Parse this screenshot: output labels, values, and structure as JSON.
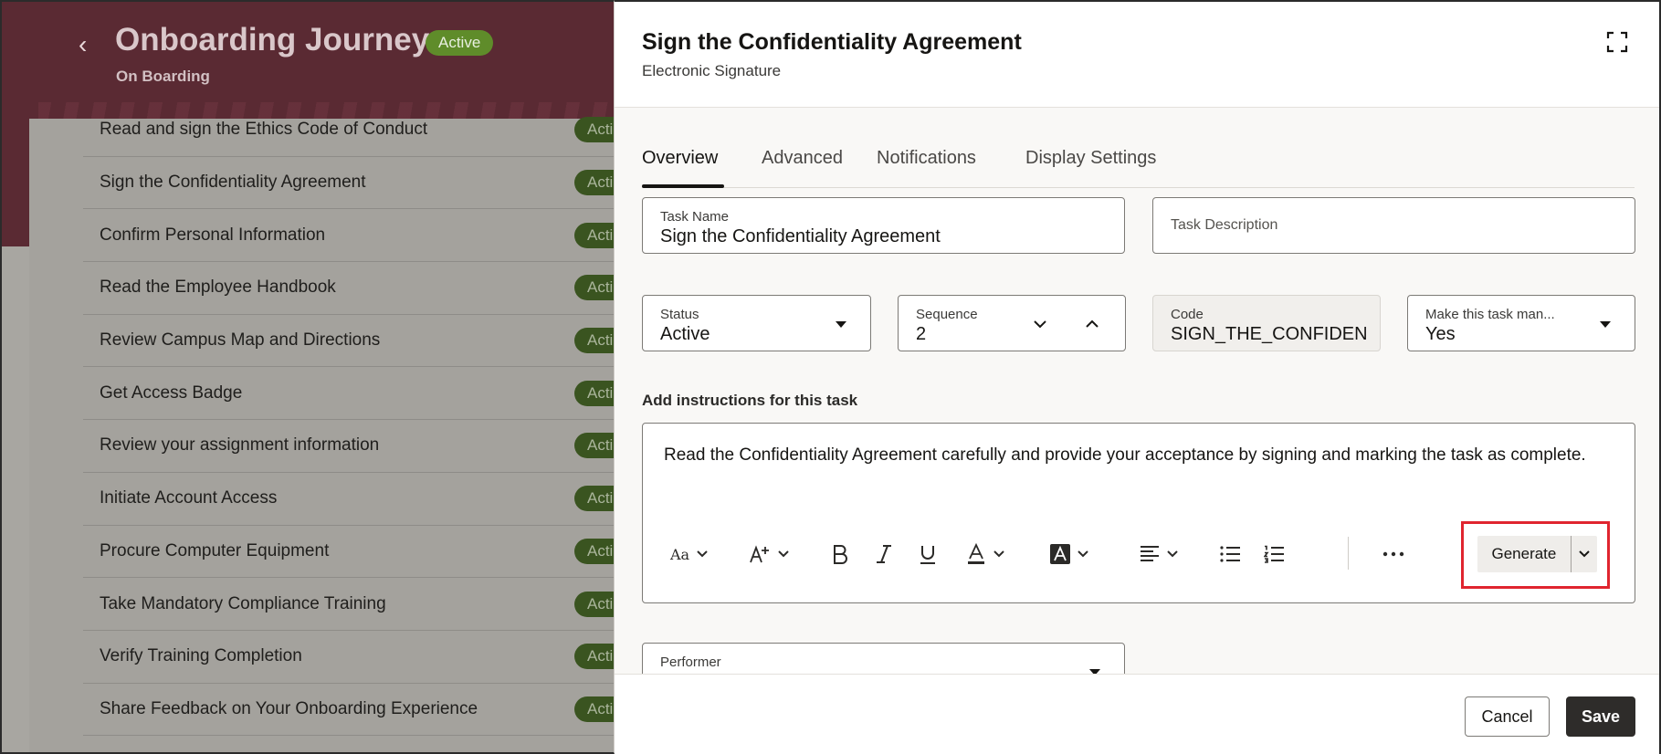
{
  "journey": {
    "title": "Onboarding Journey",
    "status_badge": "Active",
    "subtitle": "On Boarding",
    "tasks": [
      {
        "label": "Read and sign the Ethics Code of Conduct",
        "badge": "Acti"
      },
      {
        "label": "Sign the Confidentiality Agreement",
        "badge": "Acti"
      },
      {
        "label": "Confirm Personal Information",
        "badge": "Acti"
      },
      {
        "label": "Read the Employee Handbook",
        "badge": "Acti"
      },
      {
        "label": "Review Campus Map and Directions",
        "badge": "Acti"
      },
      {
        "label": "Get Access Badge",
        "badge": "Acti"
      },
      {
        "label": "Review your assignment information",
        "badge": "Acti"
      },
      {
        "label": "Initiate Account Access",
        "badge": "Acti"
      },
      {
        "label": "Procure Computer Equipment",
        "badge": "Acti"
      },
      {
        "label": "Take Mandatory Compliance Training",
        "badge": "Acti"
      },
      {
        "label": "Verify Training Completion",
        "badge": "Acti"
      },
      {
        "label": "Share Feedback on Your Onboarding Experience",
        "badge": "Acti"
      }
    ]
  },
  "drawer": {
    "title": "Sign the Confidentiality Agreement",
    "subtitle": "Electronic Signature",
    "tabs": [
      "Overview",
      "Advanced",
      "Notifications",
      "Display Settings"
    ],
    "active_tab": "Overview",
    "fields": {
      "task_name": {
        "label": "Task Name",
        "value": "Sign the Confidentiality Agreement"
      },
      "task_description": {
        "label": "Task Description",
        "value": ""
      },
      "status": {
        "label": "Status",
        "value": "Active"
      },
      "sequence": {
        "label": "Sequence",
        "value": "2"
      },
      "code": {
        "label": "Code",
        "value": "SIGN_THE_CONFIDENTI"
      },
      "mandatory": {
        "label": "Make this task man...",
        "value": "Yes"
      },
      "performer": {
        "label": "Performer",
        "value": ""
      }
    },
    "instructions": {
      "label": "Add instructions for this task",
      "text": "Read the Confidentiality Agreement carefully and provide your acceptance by signing and marking the task as complete."
    },
    "toolbar": {
      "font_icon_text": "Aa",
      "generate_label": "Generate"
    },
    "footer": {
      "cancel_label": "Cancel",
      "save_label": "Save"
    }
  },
  "colors": {
    "header_bg": "#5a2a33",
    "badge_green": "#5f8c2a",
    "highlight_red": "#e0252f",
    "save_bg": "#2e2c2a"
  }
}
